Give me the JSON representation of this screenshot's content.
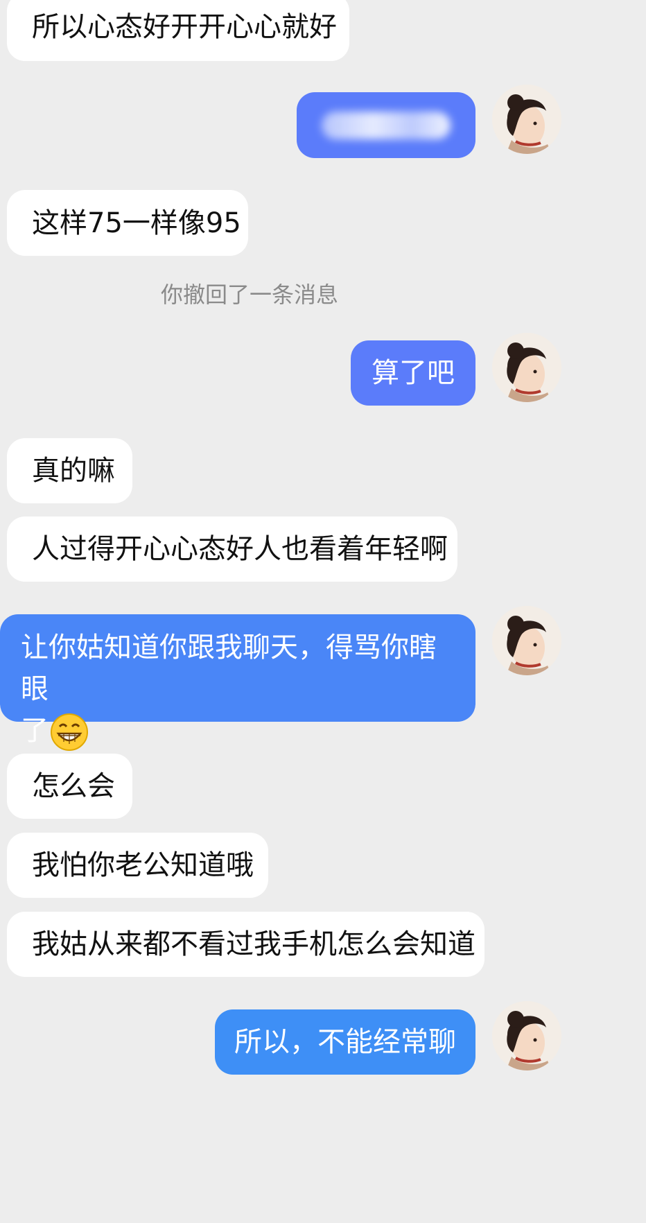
{
  "messages": [
    {
      "side": "in",
      "text": "所以心态好开开心心就好"
    },
    {
      "side": "out",
      "text": "",
      "blurred": true,
      "color": "#5b7cfa"
    },
    {
      "side": "in",
      "text": "这样75一样像95"
    },
    {
      "side": "system",
      "text": "你撤回了一条消息"
    },
    {
      "side": "out",
      "text": "算了吧",
      "color": "#5b7cfa"
    },
    {
      "side": "in",
      "text": "真的嘛"
    },
    {
      "side": "in",
      "text": "人过得开心心态好人也看着年轻啊"
    },
    {
      "side": "out",
      "line1": "让你姑知道你跟我聊天，得骂你瞎眼",
      "line2": "了",
      "emoji": "grinning-face",
      "color": "#4a86f7"
    },
    {
      "side": "in",
      "text": "怎么会"
    },
    {
      "side": "in",
      "text": "我怕你老公知道哦"
    },
    {
      "side": "in",
      "text": "我姑从来都不看过我手机怎么会知道"
    },
    {
      "side": "out",
      "text": "所以，不能经常聊",
      "color": "#3e8ff6"
    }
  ],
  "colors": {
    "background": "#ededed",
    "incoming_bubble": "#ffffff",
    "outgoing_bubble": "#5b7cfa",
    "system_text": "#8a8a8a"
  },
  "avatar": {
    "icon": "user-avatar-woman-illustration"
  }
}
